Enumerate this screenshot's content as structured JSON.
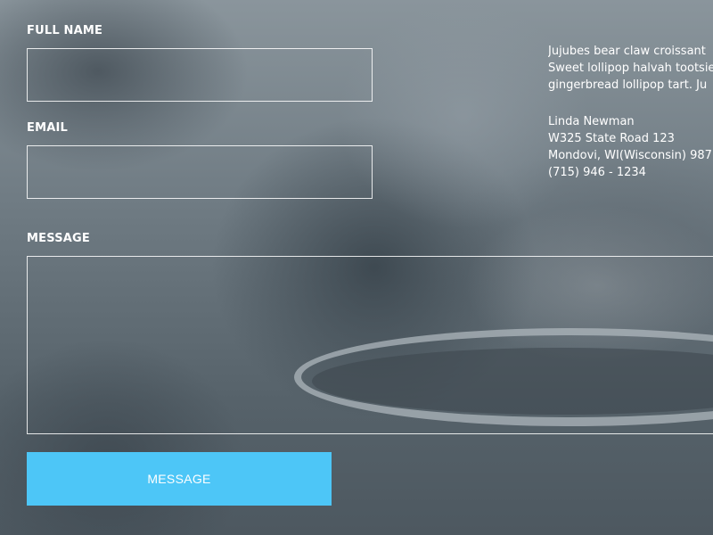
{
  "form": {
    "name_label": "FULL NAME",
    "name_value": "",
    "email_label": "EMAIL",
    "email_value": "",
    "message_label": "MESSAGE",
    "message_value": "",
    "submit_label": "MESSAGE"
  },
  "info": {
    "text_lines": [
      "Jujubes bear claw croissant",
      "Sweet lollipop halvah tootsie",
      "gingerbread lollipop tart. Ju"
    ],
    "address_lines": [
      "Linda Newman",
      "W325 State Road 123",
      "Mondovi, WI(Wisconsin) 987",
      "(715) 946 - 1234"
    ]
  },
  "colors": {
    "button": "#4dc6f7",
    "text": "#ffffff",
    "field_border": "#ffffff"
  }
}
